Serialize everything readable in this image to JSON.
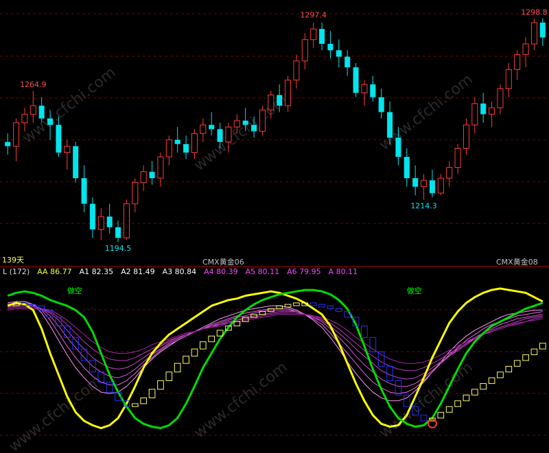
{
  "chart_data": [
    {
      "type": "candlestick",
      "price_range": [
        1188,
        1305
      ],
      "up_color": "#ff3b3b",
      "down_color": "#00e5ee",
      "grid": true,
      "candles": [
        [
          1241,
          1245,
          1235,
          1239
        ],
        [
          1239,
          1252,
          1232,
          1250
        ],
        [
          1250,
          1257,
          1246,
          1254
        ],
        [
          1254,
          1265,
          1250,
          1258
        ],
        [
          1258,
          1262,
          1250,
          1252
        ],
        [
          1252,
          1256,
          1242,
          1249
        ],
        [
          1249,
          1253,
          1234,
          1236
        ],
        [
          1236,
          1242,
          1228,
          1239
        ],
        [
          1239,
          1241,
          1222,
          1224
        ],
        [
          1224,
          1230,
          1208,
          1212
        ],
        [
          1212,
          1215,
          1196,
          1200
        ],
        [
          1200,
          1210,
          1195,
          1206
        ],
        [
          1206,
          1212,
          1198,
          1201
        ],
        [
          1201,
          1204,
          1194,
          1196
        ],
        [
          1196,
          1214,
          1195,
          1212
        ],
        [
          1212,
          1224,
          1208,
          1222
        ],
        [
          1222,
          1230,
          1218,
          1227
        ],
        [
          1227,
          1232,
          1221,
          1224
        ],
        [
          1224,
          1236,
          1220,
          1234
        ],
        [
          1234,
          1244,
          1230,
          1242
        ],
        [
          1242,
          1248,
          1236,
          1240
        ],
        [
          1240,
          1244,
          1233,
          1236
        ],
        [
          1236,
          1247,
          1233,
          1245
        ],
        [
          1245,
          1252,
          1241,
          1249
        ],
        [
          1249,
          1255,
          1244,
          1247
        ],
        [
          1247,
          1250,
          1238,
          1241
        ],
        [
          1241,
          1250,
          1236,
          1248
        ],
        [
          1248,
          1254,
          1245,
          1251
        ],
        [
          1251,
          1257,
          1246,
          1249
        ],
        [
          1249,
          1253,
          1243,
          1246
        ],
        [
          1246,
          1258,
          1244,
          1256
        ],
        [
          1256,
          1265,
          1252,
          1263
        ],
        [
          1263,
          1268,
          1255,
          1258
        ],
        [
          1258,
          1272,
          1255,
          1270
        ],
        [
          1270,
          1282,
          1266,
          1279
        ],
        [
          1279,
          1292,
          1275,
          1289
        ],
        [
          1289,
          1297,
          1285,
          1294
        ],
        [
          1294,
          1297,
          1284,
          1287
        ],
        [
          1287,
          1293,
          1280,
          1284
        ],
        [
          1284,
          1289,
          1276,
          1281
        ],
        [
          1281,
          1284,
          1272,
          1276
        ],
        [
          1276,
          1278,
          1262,
          1264
        ],
        [
          1264,
          1270,
          1258,
          1268
        ],
        [
          1268,
          1272,
          1260,
          1262
        ],
        [
          1262,
          1266,
          1252,
          1255
        ],
        [
          1255,
          1260,
          1240,
          1243
        ],
        [
          1243,
          1248,
          1230,
          1234
        ],
        [
          1234,
          1238,
          1220,
          1224
        ],
        [
          1224,
          1230,
          1216,
          1220
        ],
        [
          1220,
          1226,
          1214,
          1223
        ],
        [
          1223,
          1228,
          1215,
          1217
        ],
        [
          1217,
          1226,
          1216,
          1224
        ],
        [
          1224,
          1232,
          1220,
          1229
        ],
        [
          1229,
          1240,
          1226,
          1238
        ],
        [
          1238,
          1252,
          1235,
          1249
        ],
        [
          1249,
          1262,
          1245,
          1259
        ],
        [
          1259,
          1264,
          1250,
          1254
        ],
        [
          1254,
          1260,
          1248,
          1257
        ],
        [
          1257,
          1268,
          1254,
          1266
        ],
        [
          1266,
          1278,
          1262,
          1275
        ],
        [
          1275,
          1284,
          1270,
          1282
        ],
        [
          1282,
          1290,
          1276,
          1287
        ],
        [
          1287,
          1299,
          1284,
          1297
        ],
        [
          1297,
          1299,
          1286,
          1290
        ]
      ],
      "annotations": [
        {
          "label": "1264.9",
          "candle": 3,
          "value": 1264.9,
          "pos": "above",
          "color": "#ff5050"
        },
        {
          "label": "1194.5",
          "candle": 13,
          "value": 1194.5,
          "pos": "below",
          "color": "#00e5ee"
        },
        {
          "label": "1297.4",
          "candle": 36,
          "value": 1297.4,
          "pos": "above",
          "color": "#ff5050"
        },
        {
          "label": "1214.3",
          "candle": 49,
          "value": 1214.3,
          "pos": "below",
          "color": "#00e5ee"
        },
        {
          "label": "1298.8",
          "candle": 62,
          "value": 1298.8,
          "pos": "above",
          "color": "#ff5050"
        }
      ],
      "footer_left": "139天",
      "footer_mid": "CMX黄金06",
      "footer_right": "CMX黄金08"
    },
    {
      "type": "line",
      "y_range": [
        -10,
        110
      ],
      "legend": [
        {
          "text": "L (172)",
          "color": "#dddddd"
        },
        {
          "text": "AA 86.77",
          "color": "#ffff33"
        },
        {
          "text": "A1 82.35",
          "color": "#ffffff"
        },
        {
          "text": "A2 81.49",
          "color": "#ffffff"
        },
        {
          "text": "A3 80.84",
          "color": "#ffffff"
        },
        {
          "text": "A4 80.39",
          "color": "#ff44ff"
        },
        {
          "text": "A5 80.11",
          "color": "#ff44ff"
        },
        {
          "text": "A6 79.95",
          "color": "#ff44ff"
        },
        {
          "text": "A 80.11",
          "color": "#ff44ff"
        }
      ],
      "markers": [
        {
          "text": "做空",
          "x": 7,
          "color": "#00ff00"
        },
        {
          "text": "做空",
          "x": 47,
          "color": "#00ff00"
        }
      ],
      "series": [
        {
          "color": "#ffff00",
          "width": 3,
          "values": [
            88,
            90,
            89,
            85,
            72,
            55,
            40,
            25,
            14,
            8,
            5,
            3,
            5,
            10,
            20,
            32,
            45,
            55,
            62,
            68,
            72,
            76,
            80,
            84,
            88,
            90,
            92,
            93,
            95,
            96,
            97,
            98,
            97,
            95,
            93,
            90,
            86,
            82,
            74,
            62,
            48,
            34,
            22,
            12,
            6,
            4,
            5,
            12,
            25,
            38,
            52,
            64,
            76,
            84,
            90,
            94,
            97,
            99,
            100,
            99,
            98,
            97,
            94,
            91
          ]
        },
        {
          "color": "#00dd00",
          "width": 3,
          "values": [
            95,
            97,
            98,
            97,
            95,
            92,
            90,
            88,
            85,
            80,
            70,
            55,
            40,
            28,
            18,
            10,
            6,
            4,
            3,
            5,
            10,
            20,
            32,
            45,
            55,
            65,
            73,
            80,
            85,
            89,
            92,
            94,
            96,
            97,
            98,
            99,
            99,
            98,
            96,
            92,
            86,
            75,
            60,
            44,
            30,
            18,
            10,
            6,
            4,
            5,
            10,
            20,
            32,
            44,
            55,
            63,
            69,
            74,
            77,
            80,
            83,
            86,
            88,
            90
          ]
        },
        {
          "color": "#ff99ff",
          "width": 1,
          "values": [
            90,
            91,
            91,
            89,
            83,
            74,
            64,
            54,
            45,
            38,
            32,
            28,
            27,
            28,
            32,
            38,
            45,
            51,
            56,
            60,
            64,
            67,
            70,
            73,
            76,
            79,
            81,
            83,
            85,
            86,
            87,
            88,
            88,
            87,
            85,
            82,
            78,
            73,
            66,
            58,
            49,
            41,
            34,
            28,
            24,
            22,
            22,
            24,
            29,
            35,
            42,
            49,
            56,
            62,
            67,
            71,
            74,
            77,
            80,
            82,
            83,
            84,
            85,
            85
          ]
        },
        {
          "color": "#ee66ee",
          "width": 1,
          "values": [
            89,
            90,
            90,
            89,
            85,
            78,
            69,
            60,
            52,
            45,
            39,
            35,
            33,
            33,
            36,
            41,
            47,
            52,
            57,
            61,
            64,
            67,
            70,
            72,
            75,
            77,
            79,
            81,
            83,
            84,
            85,
            86,
            86,
            86,
            84,
            82,
            79,
            75,
            69,
            62,
            55,
            48,
            41,
            35,
            31,
            28,
            27,
            28,
            31,
            36,
            42,
            48,
            54,
            59,
            64,
            68,
            72,
            75,
            77,
            79,
            81,
            82,
            83,
            84
          ]
        },
        {
          "color": "#dd55dd",
          "width": 1,
          "values": [
            88,
            89,
            89,
            88,
            86,
            81,
            74,
            66,
            59,
            52,
            46,
            42,
            39,
            38,
            40,
            44,
            49,
            54,
            58,
            62,
            65,
            68,
            70,
            72,
            74,
            76,
            78,
            80,
            81,
            83,
            84,
            85,
            85,
            85,
            84,
            82,
            80,
            77,
            72,
            66,
            60,
            53,
            47,
            42,
            37,
            34,
            32,
            32,
            34,
            38,
            43,
            48,
            53,
            58,
            62,
            66,
            69,
            72,
            75,
            77,
            79,
            80,
            81,
            82
          ]
        },
        {
          "color": "#cc44cc",
          "width": 1,
          "values": [
            87,
            88,
            88,
            88,
            86,
            83,
            78,
            71,
            64,
            58,
            52,
            48,
            45,
            44,
            45,
            48,
            52,
            56,
            60,
            63,
            66,
            68,
            70,
            72,
            74,
            75,
            77,
            78,
            80,
            81,
            82,
            83,
            84,
            84,
            84,
            82,
            80,
            78,
            74,
            69,
            64,
            58,
            53,
            48,
            43,
            40,
            38,
            37,
            38,
            41,
            45,
            49,
            53,
            57,
            61,
            65,
            68,
            71,
            73,
            75,
            77,
            79,
            80,
            81
          ]
        },
        {
          "color": "#bb33bb",
          "width": 1,
          "values": [
            86,
            87,
            87,
            87,
            86,
            84,
            80,
            75,
            69,
            63,
            58,
            54,
            51,
            50,
            50,
            52,
            55,
            58,
            61,
            64,
            66,
            68,
            70,
            72,
            73,
            75,
            76,
            78,
            79,
            80,
            81,
            82,
            83,
            83,
            83,
            82,
            81,
            79,
            76,
            72,
            67,
            62,
            57,
            53,
            49,
            46,
            44,
            43,
            43,
            45,
            48,
            51,
            55,
            58,
            62,
            65,
            68,
            70,
            72,
            74,
            76,
            77,
            79,
            80
          ]
        },
        {
          "color": "#aa22aa",
          "width": 1,
          "values": [
            85,
            86,
            86,
            86,
            86,
            85,
            82,
            78,
            73,
            68,
            63,
            59,
            56,
            55,
            55,
            56,
            58,
            61,
            63,
            65,
            67,
            69,
            70,
            72,
            73,
            74,
            76,
            77,
            78,
            79,
            80,
            81,
            82,
            82,
            82,
            82,
            81,
            80,
            78,
            75,
            71,
            66,
            62,
            58,
            54,
            51,
            49,
            48,
            48,
            49,
            51,
            54,
            57,
            60,
            63,
            66,
            68,
            70,
            72,
            74,
            75,
            77,
            78,
            79
          ]
        }
      ],
      "boxes": {
        "values": [
          88,
          90,
          89,
          88,
          85,
          80,
          74,
          66,
          58,
          50,
          42,
          35,
          28,
          22,
          18,
          20,
          24,
          30,
          36,
          42,
          48,
          53,
          58,
          63,
          67,
          71,
          74,
          77,
          80,
          82,
          84,
          86,
          88,
          89,
          90,
          90,
          89,
          88,
          86,
          84,
          80,
          74,
          66,
          56,
          46,
          36,
          26,
          18,
          12,
          8,
          10,
          14,
          18,
          22,
          26,
          30,
          34,
          38,
          42,
          46,
          50,
          54,
          58,
          62
        ],
        "down_color": "#2233ff",
        "up_color": "#ffff66"
      }
    }
  ]
}
